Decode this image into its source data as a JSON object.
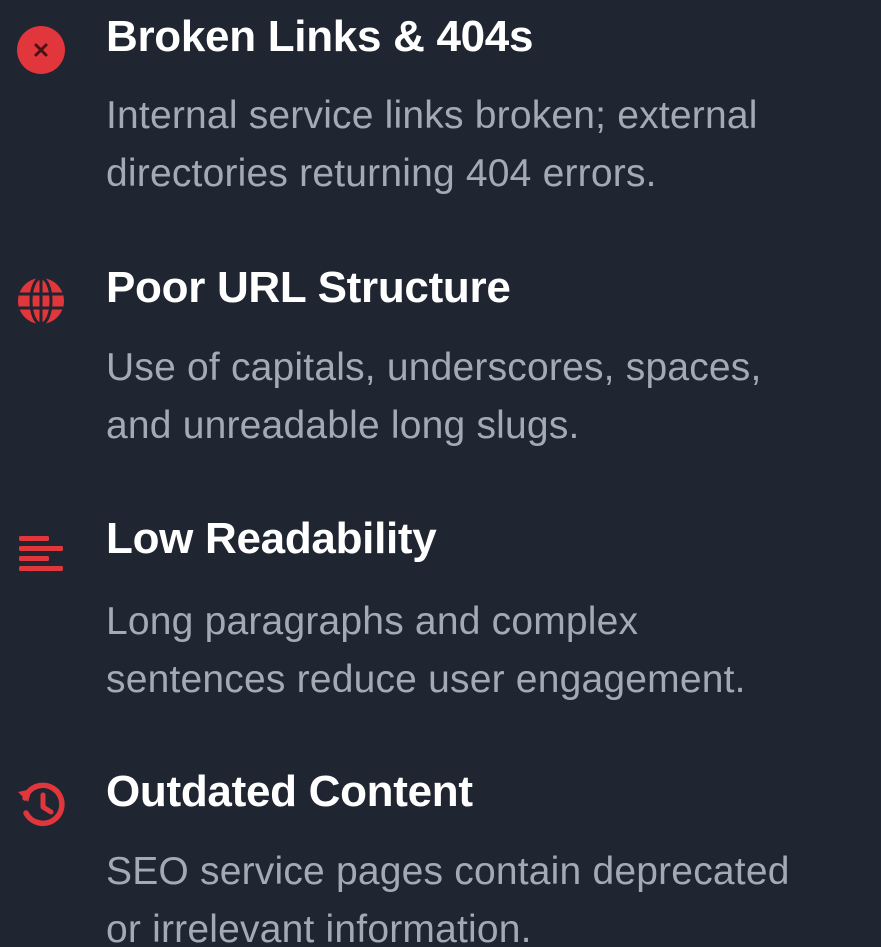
{
  "colors": {
    "background": "#1f2531",
    "accent_red": "#e0363c",
    "title": "#ffffff",
    "description": "#a3aab6"
  },
  "issues": [
    {
      "icon": "x-circle-icon",
      "title": "Broken Links & 404s",
      "line1": "Internal service links broken; external",
      "line2": "directories returning 404 errors."
    },
    {
      "icon": "globe-icon",
      "title": "Poor URL Structure",
      "line1": "Use of capitals, underscores, spaces,",
      "line2": "and unreadable long slugs."
    },
    {
      "icon": "align-left-icon",
      "title": "Low Readability",
      "line1": "Long paragraphs and complex",
      "line2": "sentences reduce user engagement."
    },
    {
      "icon": "history-icon",
      "title": "Outdated Content",
      "line1": "SEO service pages contain deprecated",
      "line2": "or irrelevant information."
    }
  ]
}
